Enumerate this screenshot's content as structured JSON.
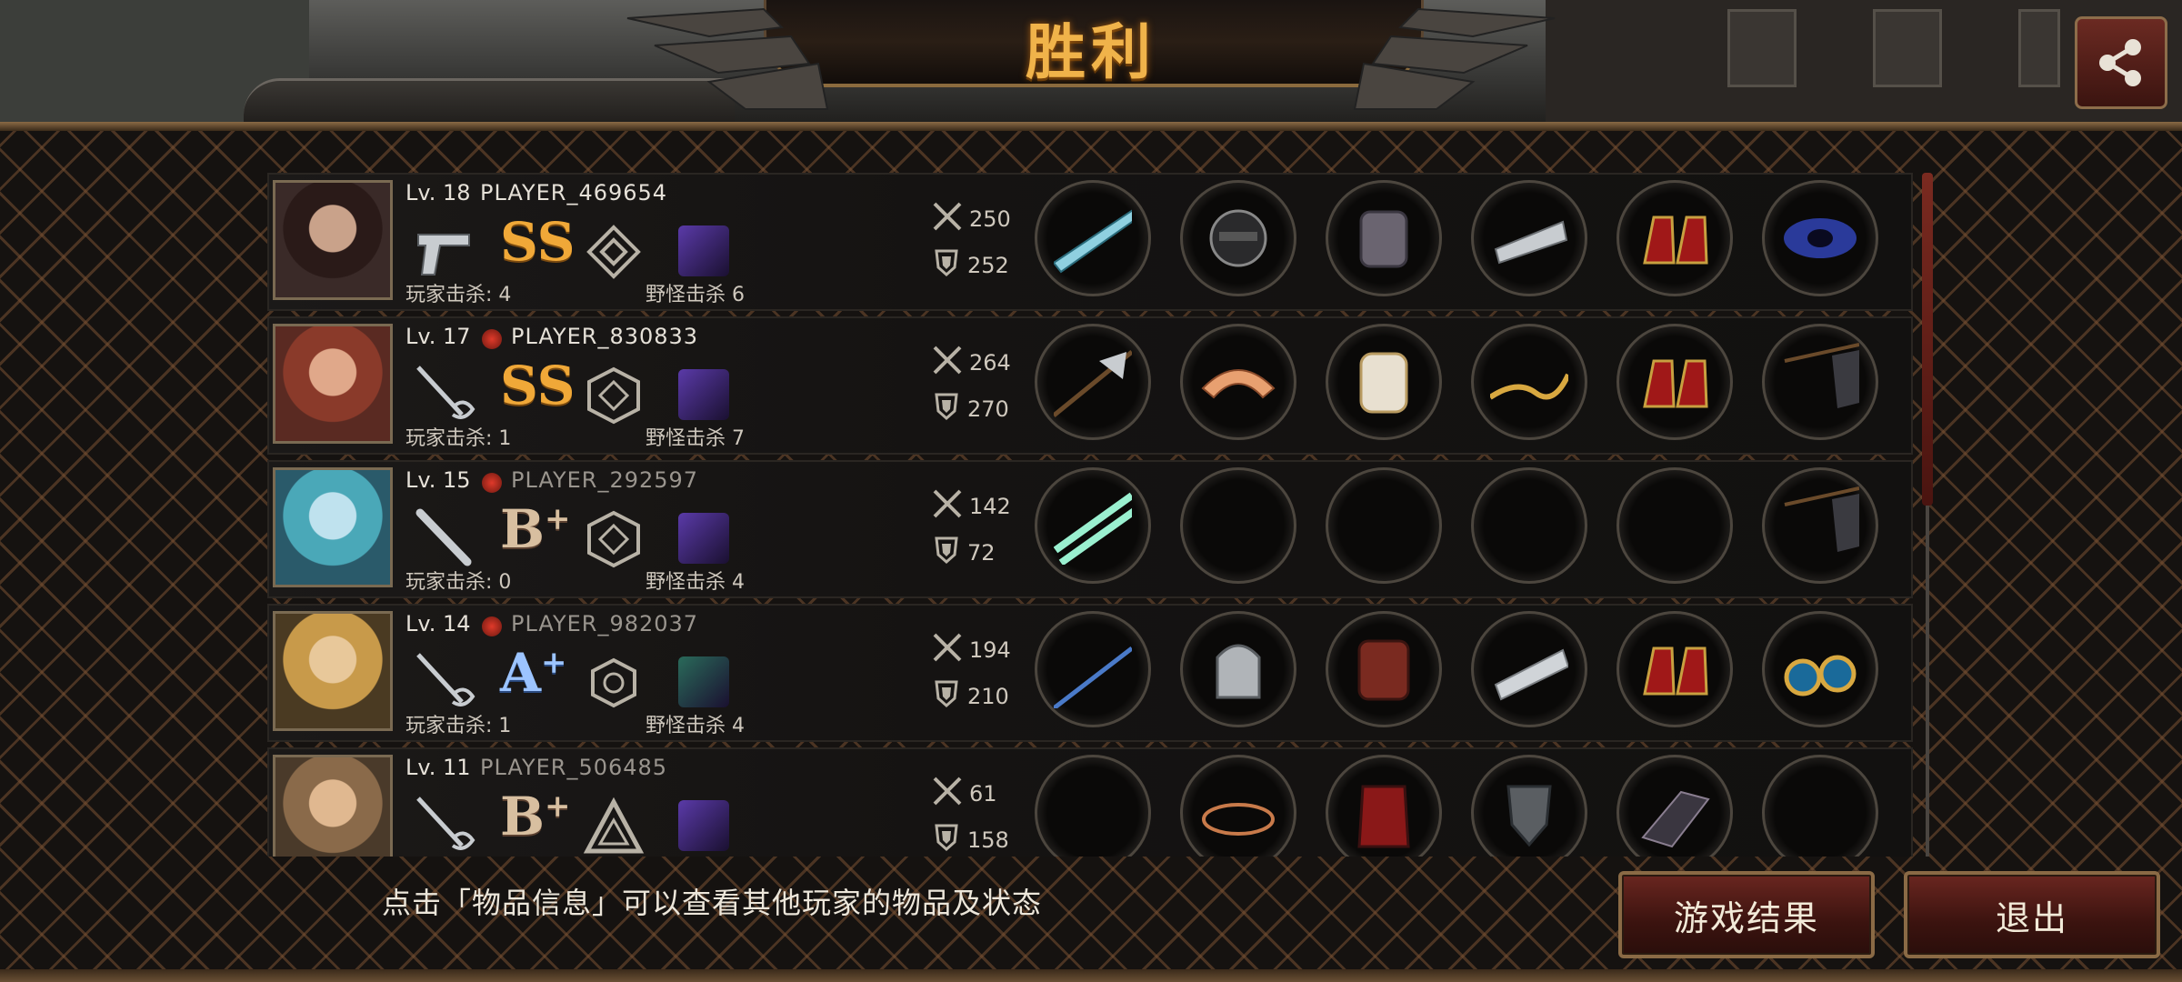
{
  "title": "胜利",
  "header": {
    "player_partial": "PLAYER_469654"
  },
  "players": [
    {
      "level": "Lv. 18",
      "name": "PLAYER_469654",
      "weapon_icon": "pistol-icon",
      "grade": "SS",
      "grade_plus": "",
      "player_kills": "玩家击杀: 4",
      "monster_kills": "野怪击杀 6",
      "attack": "250",
      "defense": "252",
      "items": [
        "laser-rifle-icon",
        "tactical-helmet-icon",
        "power-armor-icon",
        "blade-gauntlet-icon",
        "red-heels-icon",
        "galaxy-orb-icon"
      ]
    },
    {
      "level": "Lv. 17",
      "name": "PLAYER_830833",
      "weapon_icon": "rapier-icon",
      "grade": "SS",
      "grade_plus": "",
      "player_kills": "玩家击杀: 1",
      "monster_kills": "野怪击杀 7",
      "attack": "264",
      "defense": "270",
      "items": [
        "halberd-icon",
        "winged-circlet-icon",
        "white-armor-icon",
        "golden-whip-icon",
        "red-heels-icon",
        "war-flag-icon"
      ]
    },
    {
      "level": "Lv. 15",
      "name": "PLAYER_292597",
      "weapon_icon": "bat-icon",
      "grade": "B",
      "grade_plus": "+",
      "player_kills": "玩家击杀: 0",
      "monster_kills": "野怪击杀 4",
      "attack": "142",
      "defense": "72",
      "items": [
        "dual-lightsaber-icon",
        "",
        "",
        "",
        "",
        "war-flag-icon"
      ]
    },
    {
      "level": "Lv. 14",
      "name": "PLAYER_982037",
      "weapon_icon": "rapier-icon",
      "grade": "A",
      "grade_plus": "+",
      "player_kills": "玩家击杀: 1",
      "monster_kills": "野怪击杀 4",
      "attack": "194",
      "defense": "210",
      "items": [
        "blue-spear-icon",
        "knight-helmet-icon",
        "red-armor-icon",
        "silver-bracer-icon",
        "red-heels-icon",
        "jeweled-earrings-icon"
      ]
    },
    {
      "level": "Lv. 11",
      "name": "PLAYER_506485",
      "weapon_icon": "rapier-icon",
      "grade": "B",
      "grade_plus": "+",
      "player_kills": "",
      "monster_kills": "",
      "attack": "61",
      "defense": "158",
      "items": [
        "",
        "copper-ring-icon",
        "red-cape-armor-icon",
        "iron-shield-icon",
        "claw-gauntlet-icon",
        ""
      ]
    }
  ],
  "hint": "点击「物品信息」可以查看其他玩家的物品及状态",
  "buttons": {
    "results": "游戏结果",
    "exit": "退出"
  },
  "colors": {
    "title": "#f0b34a",
    "button": "#6a2620",
    "frame": "#8a6a45"
  }
}
